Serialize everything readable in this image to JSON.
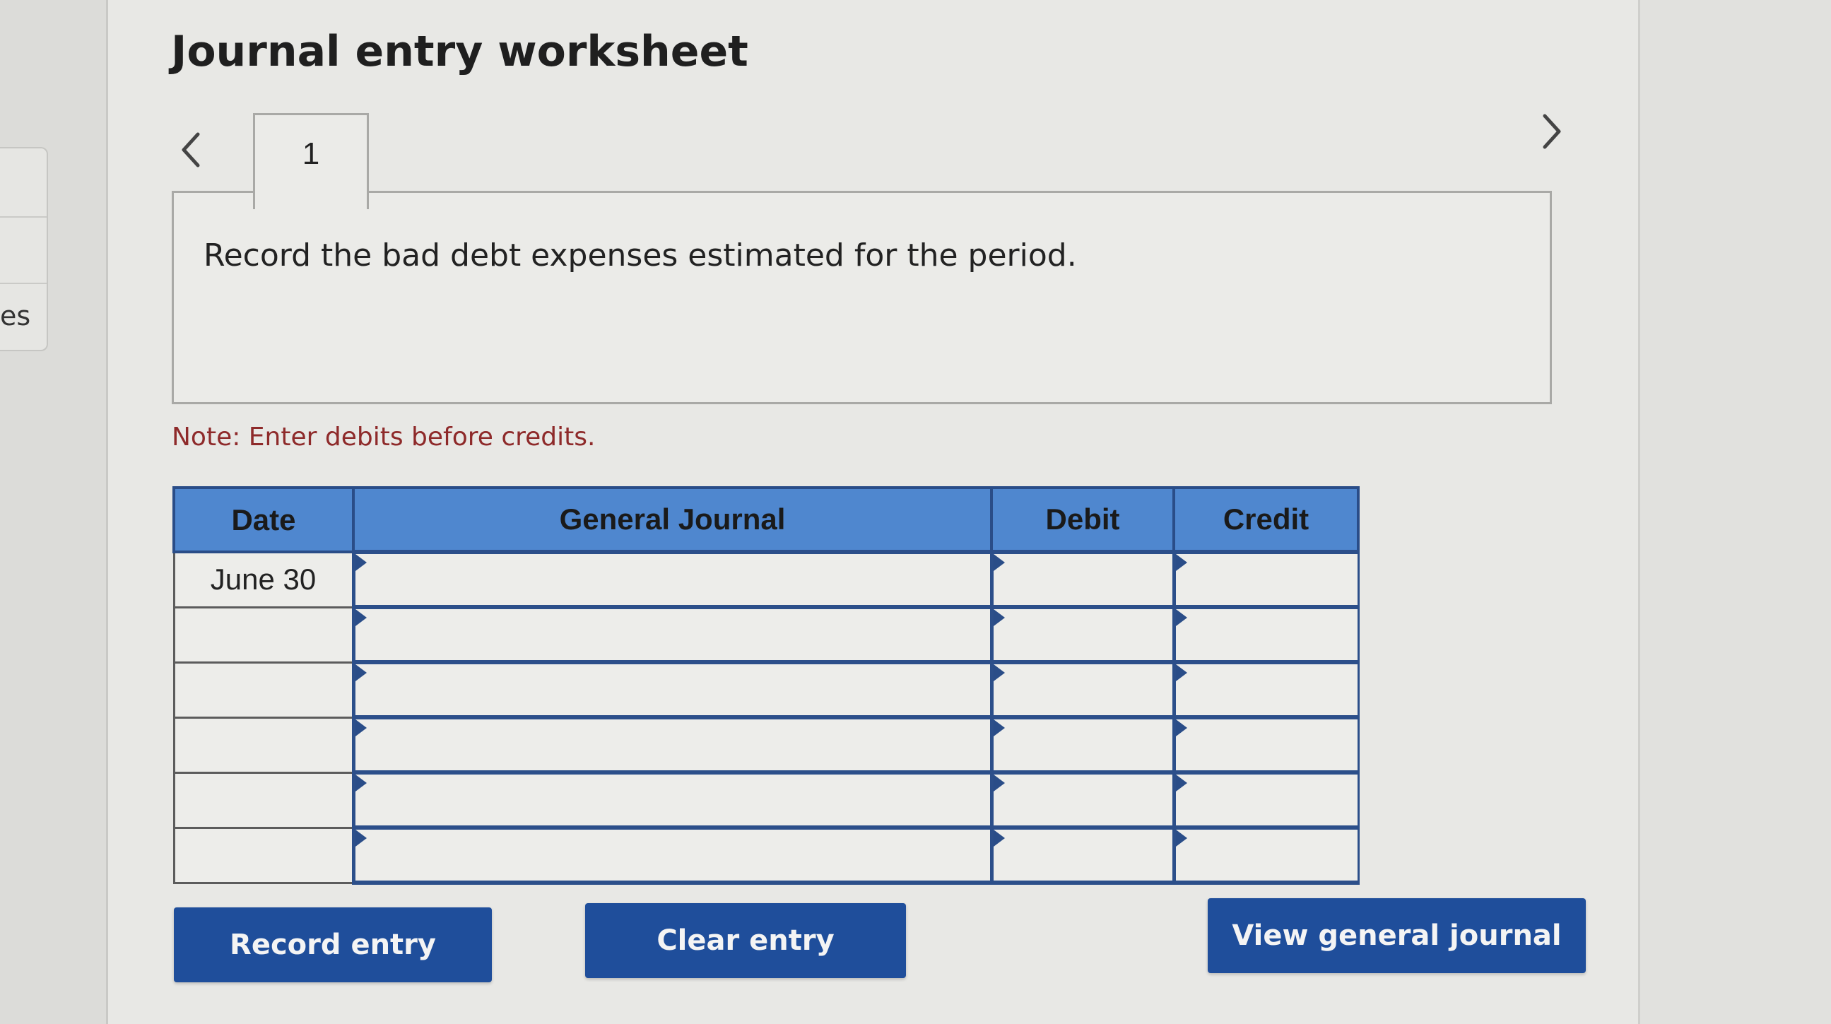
{
  "sidebar": {
    "partial_label": "es"
  },
  "worksheet": {
    "title": "Journal entry worksheet",
    "tabs": [
      {
        "label": "1"
      }
    ],
    "prev_icon": "chevron-left-icon",
    "next_icon": "chevron-right-icon",
    "prompt": "Record the bad debt expenses estimated for the period.",
    "note": "Note: Enter debits before credits."
  },
  "journal": {
    "headers": {
      "date": "Date",
      "general_journal": "General Journal",
      "debit": "Debit",
      "credit": "Credit"
    },
    "rows": [
      {
        "date": "June 30",
        "account": "",
        "debit": "",
        "credit": ""
      },
      {
        "date": "",
        "account": "",
        "debit": "",
        "credit": ""
      },
      {
        "date": "",
        "account": "",
        "debit": "",
        "credit": ""
      },
      {
        "date": "",
        "account": "",
        "debit": "",
        "credit": ""
      },
      {
        "date": "",
        "account": "",
        "debit": "",
        "credit": ""
      },
      {
        "date": "",
        "account": "",
        "debit": "",
        "credit": ""
      }
    ]
  },
  "actions": {
    "record_entry": "Record entry",
    "clear_entry": "Clear entry",
    "view_general_journal": "View general journal"
  },
  "colors": {
    "header_blue": "#4f87cf",
    "button_blue": "#1f4e9b",
    "note_red": "#8e2a2a",
    "border_blue": "#2c4f8a"
  }
}
